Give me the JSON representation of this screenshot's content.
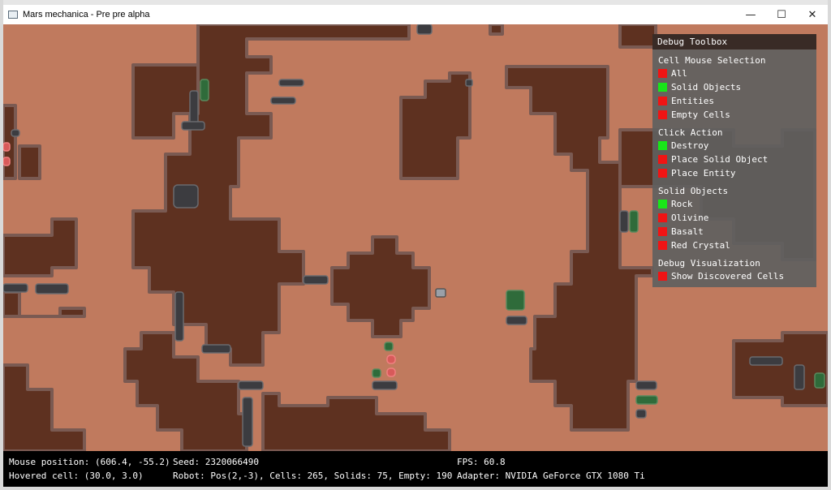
{
  "window": {
    "title": "Mars mechanica - Pre pre alpha",
    "minimize_glyph": "—",
    "maximize_glyph": "☐",
    "close_glyph": "✕"
  },
  "colors": {
    "ground": "#c07a5e",
    "rock": "#5e3120",
    "rock_edge": "#7a5a52",
    "basalt": "#3c3c40",
    "olivine": "#2f6b3a",
    "red_crystal": "#d85a5a",
    "toggle_on": "#19e619",
    "toggle_off": "#f01414"
  },
  "toolbox": {
    "title": "Debug Toolbox",
    "sections": [
      {
        "title": "Cell Mouse Selection",
        "options": [
          {
            "label": "All",
            "enabled": false
          },
          {
            "label": "Solid Objects",
            "enabled": true
          },
          {
            "label": "Entities",
            "enabled": false
          },
          {
            "label": "Empty Cells",
            "enabled": false
          }
        ]
      },
      {
        "title": "Click Action",
        "options": [
          {
            "label": "Destroy",
            "enabled": true
          },
          {
            "label": "Place Solid Object",
            "enabled": false
          },
          {
            "label": "Place Entity",
            "enabled": false
          }
        ]
      },
      {
        "title": "Solid Objects",
        "options": [
          {
            "label": "Rock",
            "enabled": true
          },
          {
            "label": "Olivine",
            "enabled": false
          },
          {
            "label": "Basalt",
            "enabled": false
          },
          {
            "label": "Red Crystal",
            "enabled": false
          }
        ]
      },
      {
        "title": "Debug Visualization",
        "options": [
          {
            "label": "Show Discovered Cells",
            "enabled": false
          }
        ]
      }
    ]
  },
  "status": {
    "mouse_position": "Mouse position: (606.4, -55.2)",
    "hovered_cell": "Hovered cell: (30.0, 3.0)",
    "seed": "Seed: 2320066490",
    "robot": "Robot: Pos(2,-3), Cells: 265, Solids: 75, Empty: 190",
    "fps": "FPS: 60.8",
    "adapter": "Adapter: NVIDIA GeForce GTX 1080 Ti"
  }
}
